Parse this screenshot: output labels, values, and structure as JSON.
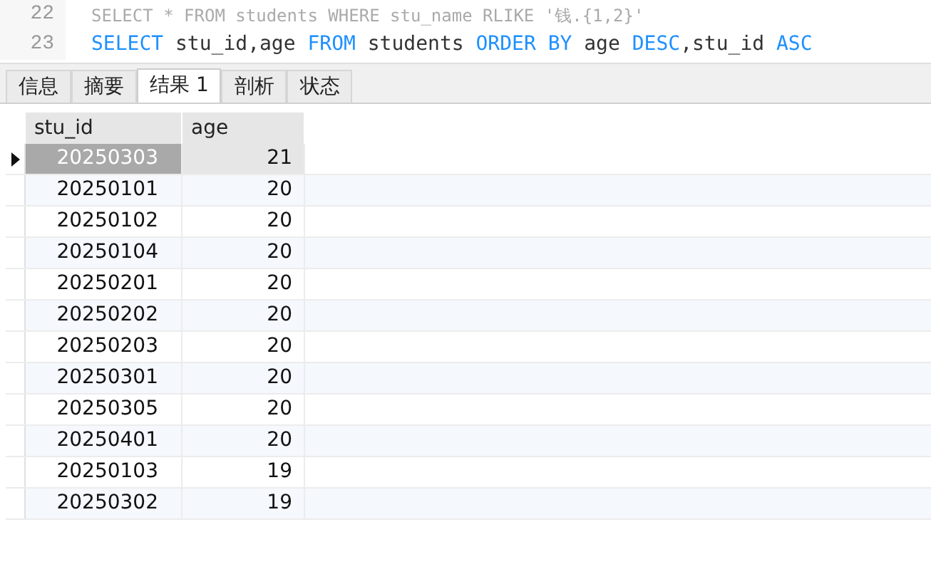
{
  "editor": {
    "lines": [
      {
        "number": "22",
        "kind": "comment",
        "text": "SELECT * FROM students WHERE stu_name RLIKE '钱.{1,2}'"
      },
      {
        "number": "23",
        "kind": "code",
        "tokens": [
          {
            "text": "SELECT",
            "keyword": true
          },
          {
            "text": " stu_id,age ",
            "keyword": false
          },
          {
            "text": "FROM",
            "keyword": true
          },
          {
            "text": " students ",
            "keyword": false
          },
          {
            "text": "ORDER BY",
            "keyword": true
          },
          {
            "text": " age ",
            "keyword": false
          },
          {
            "text": "DESC",
            "keyword": true
          },
          {
            "text": ",stu_id ",
            "keyword": false
          },
          {
            "text": "ASC",
            "keyword": true
          }
        ]
      }
    ]
  },
  "tabs": [
    {
      "label": "信息",
      "selected": false
    },
    {
      "label": "摘要",
      "selected": false
    },
    {
      "label": "结果 1",
      "selected": true
    },
    {
      "label": "剖析",
      "selected": false
    },
    {
      "label": "状态",
      "selected": false
    }
  ],
  "table": {
    "columns": [
      "stu_id",
      "age"
    ],
    "rows": [
      {
        "stu_id": "20250303",
        "age": "21",
        "selected": true
      },
      {
        "stu_id": "20250101",
        "age": "20",
        "selected": false
      },
      {
        "stu_id": "20250102",
        "age": "20",
        "selected": false
      },
      {
        "stu_id": "20250104",
        "age": "20",
        "selected": false
      },
      {
        "stu_id": "20250201",
        "age": "20",
        "selected": false
      },
      {
        "stu_id": "20250202",
        "age": "20",
        "selected": false
      },
      {
        "stu_id": "20250203",
        "age": "20",
        "selected": false
      },
      {
        "stu_id": "20250301",
        "age": "20",
        "selected": false
      },
      {
        "stu_id": "20250305",
        "age": "20",
        "selected": false
      },
      {
        "stu_id": "20250401",
        "age": "20",
        "selected": false
      },
      {
        "stu_id": "20250103",
        "age": "19",
        "selected": false
      },
      {
        "stu_id": "20250302",
        "age": "19",
        "selected": false
      }
    ]
  }
}
